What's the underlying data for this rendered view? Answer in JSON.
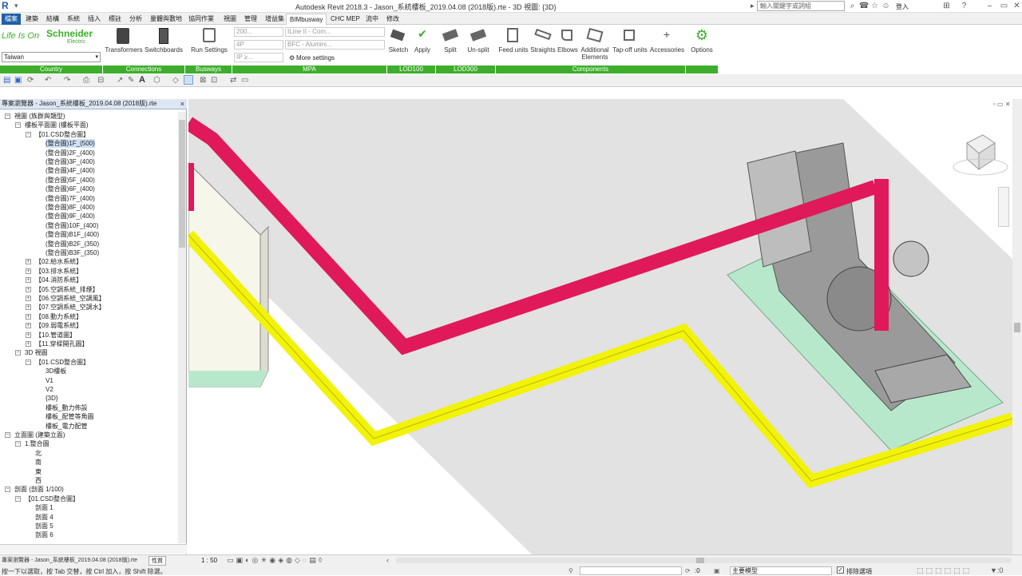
{
  "app": {
    "title": "Autodesk Revit 2018.3 -     Jason_系統樓板_2019.04.08 (2018版).rte - 3D 視圖: {3D}",
    "search_placeholder": "輸入關鍵字或詞組",
    "user_label": "登入",
    "logo_letter": "R"
  },
  "tabs": [
    "檔案",
    "建築",
    "結構",
    "系統",
    "插入",
    "標註",
    "分析",
    "量體與敷地",
    "協同作業",
    "視圖",
    "管理",
    "增益集",
    "BIMbusway",
    "CHC MEP",
    "流中",
    "修改"
  ],
  "active_tab": "BIMbusway",
  "ribbon": {
    "brand_text": "Life Is On",
    "brand_name": "Schneider",
    "brand_sub": "Electric",
    "country_value": "Taiwan",
    "buttons": {
      "transformers": "Transformers",
      "switchboards": "Switchboards",
      "run_settings": "Run Settings",
      "sketch": "Sketch",
      "apply": "Apply",
      "split": "Split",
      "unsplit": "Un-split",
      "feed_units": "Feed units",
      "straights": "Straights",
      "elbows": "Elbows",
      "additional_elements_1": "Additional",
      "additional_elements_2": "Elements",
      "tapoff_units": "Tap-off units",
      "accessories": "Accessories",
      "options": "Options"
    },
    "mpa": {
      "dropdown1": "200...",
      "dropdown2": "4P",
      "dropdown3": "IP ≥...",
      "dropdown4": "ILine II - Com...",
      "dropdown5": "BFC - Alumini...",
      "more_settings": "More settings"
    },
    "panels": {
      "country": "Country",
      "connections": "Connections",
      "busways": "Busways",
      "mpa": "MPA",
      "lod100": "LOD100",
      "lod300": "LOD300",
      "components": "Components"
    }
  },
  "browser": {
    "title": "專案瀏覽器 - Jason_系統樓板_2019.04.08 (2018版).rte",
    "close_icon": "×",
    "items": [
      {
        "label": "視圖 (族群與類型)",
        "level": 0,
        "exp": "-"
      },
      {
        "label": "樓板平面圖 (樓板平面)",
        "level": 1,
        "exp": "-"
      },
      {
        "label": "【01.CSD整合圖】",
        "level": 2,
        "exp": "-"
      },
      {
        "label": "(整合圖)1F_(500)",
        "level": 3,
        "sel": true
      },
      {
        "label": "(整合圖)2F_(400)",
        "level": 3
      },
      {
        "label": "(整合圖)3F_(400)",
        "level": 3
      },
      {
        "label": "(整合圖)4F_(400)",
        "level": 3
      },
      {
        "label": "(整合圖)5F_(400)",
        "level": 3
      },
      {
        "label": "(整合圖)6F_(400)",
        "level": 3
      },
      {
        "label": "(整合圖)7F_(400)",
        "level": 3
      },
      {
        "label": "(整合圖)8F_(400)",
        "level": 3
      },
      {
        "label": "(整合圖)9F_(400)",
        "level": 3
      },
      {
        "label": "(整合圖)10F_(400)",
        "level": 3
      },
      {
        "label": "(整合圖)B1F_(400)",
        "level": 3
      },
      {
        "label": "(整合圖)B2F_(350)",
        "level": 3
      },
      {
        "label": "(整合圖)B3F_(350)",
        "level": 3
      },
      {
        "label": "【02.給水系統】",
        "level": 2,
        "exp": "+"
      },
      {
        "label": "【03.排水系統】",
        "level": 2,
        "exp": "+"
      },
      {
        "label": "【04.消防系統】",
        "level": 2,
        "exp": "+"
      },
      {
        "label": "【05.空調系統_排煙】",
        "level": 2,
        "exp": "+"
      },
      {
        "label": "【06.空調系統_空調風】",
        "level": 2,
        "exp": "+"
      },
      {
        "label": "【07.空調系統_空調水】",
        "level": 2,
        "exp": "+"
      },
      {
        "label": "【08.動力系統】",
        "level": 2,
        "exp": "+"
      },
      {
        "label": "【09.弱電系統】",
        "level": 2,
        "exp": "+"
      },
      {
        "label": "【10.管道圖】",
        "level": 2,
        "exp": "+"
      },
      {
        "label": "【11.穿樑開孔圖】",
        "level": 2,
        "exp": "+"
      },
      {
        "label": "3D 視圖",
        "level": 1,
        "exp": "-"
      },
      {
        "label": "【01.CSD整合圖】",
        "level": 2,
        "exp": "-"
      },
      {
        "label": "3D樓板",
        "level": 3
      },
      {
        "label": "V1",
        "level": 3
      },
      {
        "label": "V2",
        "level": 3
      },
      {
        "label": "{3D}",
        "level": 3
      },
      {
        "label": "樓板_動力佈設",
        "level": 3
      },
      {
        "label": "樓板_配管等角圖",
        "level": 3
      },
      {
        "label": "樓板_電力配管",
        "level": 3
      },
      {
        "label": "立面圖 (建築立面)",
        "level": 0,
        "exp": "-"
      },
      {
        "label": "1.整合圖",
        "level": 1,
        "exp": "-"
      },
      {
        "label": "北",
        "level": 2
      },
      {
        "label": "南",
        "level": 2
      },
      {
        "label": "東",
        "level": 2
      },
      {
        "label": "西",
        "level": 2
      },
      {
        "label": "剖面 (剖面 1/100)",
        "level": 0,
        "exp": "-"
      },
      {
        "label": "【01.CSD整合圖】",
        "level": 1,
        "exp": "-"
      },
      {
        "label": "剖面 1",
        "level": 2
      },
      {
        "label": "剖面 4",
        "level": 2
      },
      {
        "label": "剖面 5",
        "level": 2
      },
      {
        "label": "剖面 6",
        "level": 2
      }
    ],
    "bottom_tab": "專案瀏覽器 - Jason_系統樓板_2019.04.08 (2018版).rte",
    "bottom_tab2": "性質"
  },
  "viewport": {
    "scale": "1 : 50"
  },
  "status": {
    "hint": "按一下以選取，按 Tab 交替，按 Ctrl 加入，按 Shift 除選。",
    "zero_value": ":0",
    "model": "主要模型",
    "exclude_options": "排除選項"
  },
  "colors": {
    "accent": "#1f5fa8",
    "panel_green": "#3dae2b",
    "busway_red": "#e0195a",
    "busway_yellow": "#f2f20a",
    "floor_green": "#b8e8cc"
  }
}
